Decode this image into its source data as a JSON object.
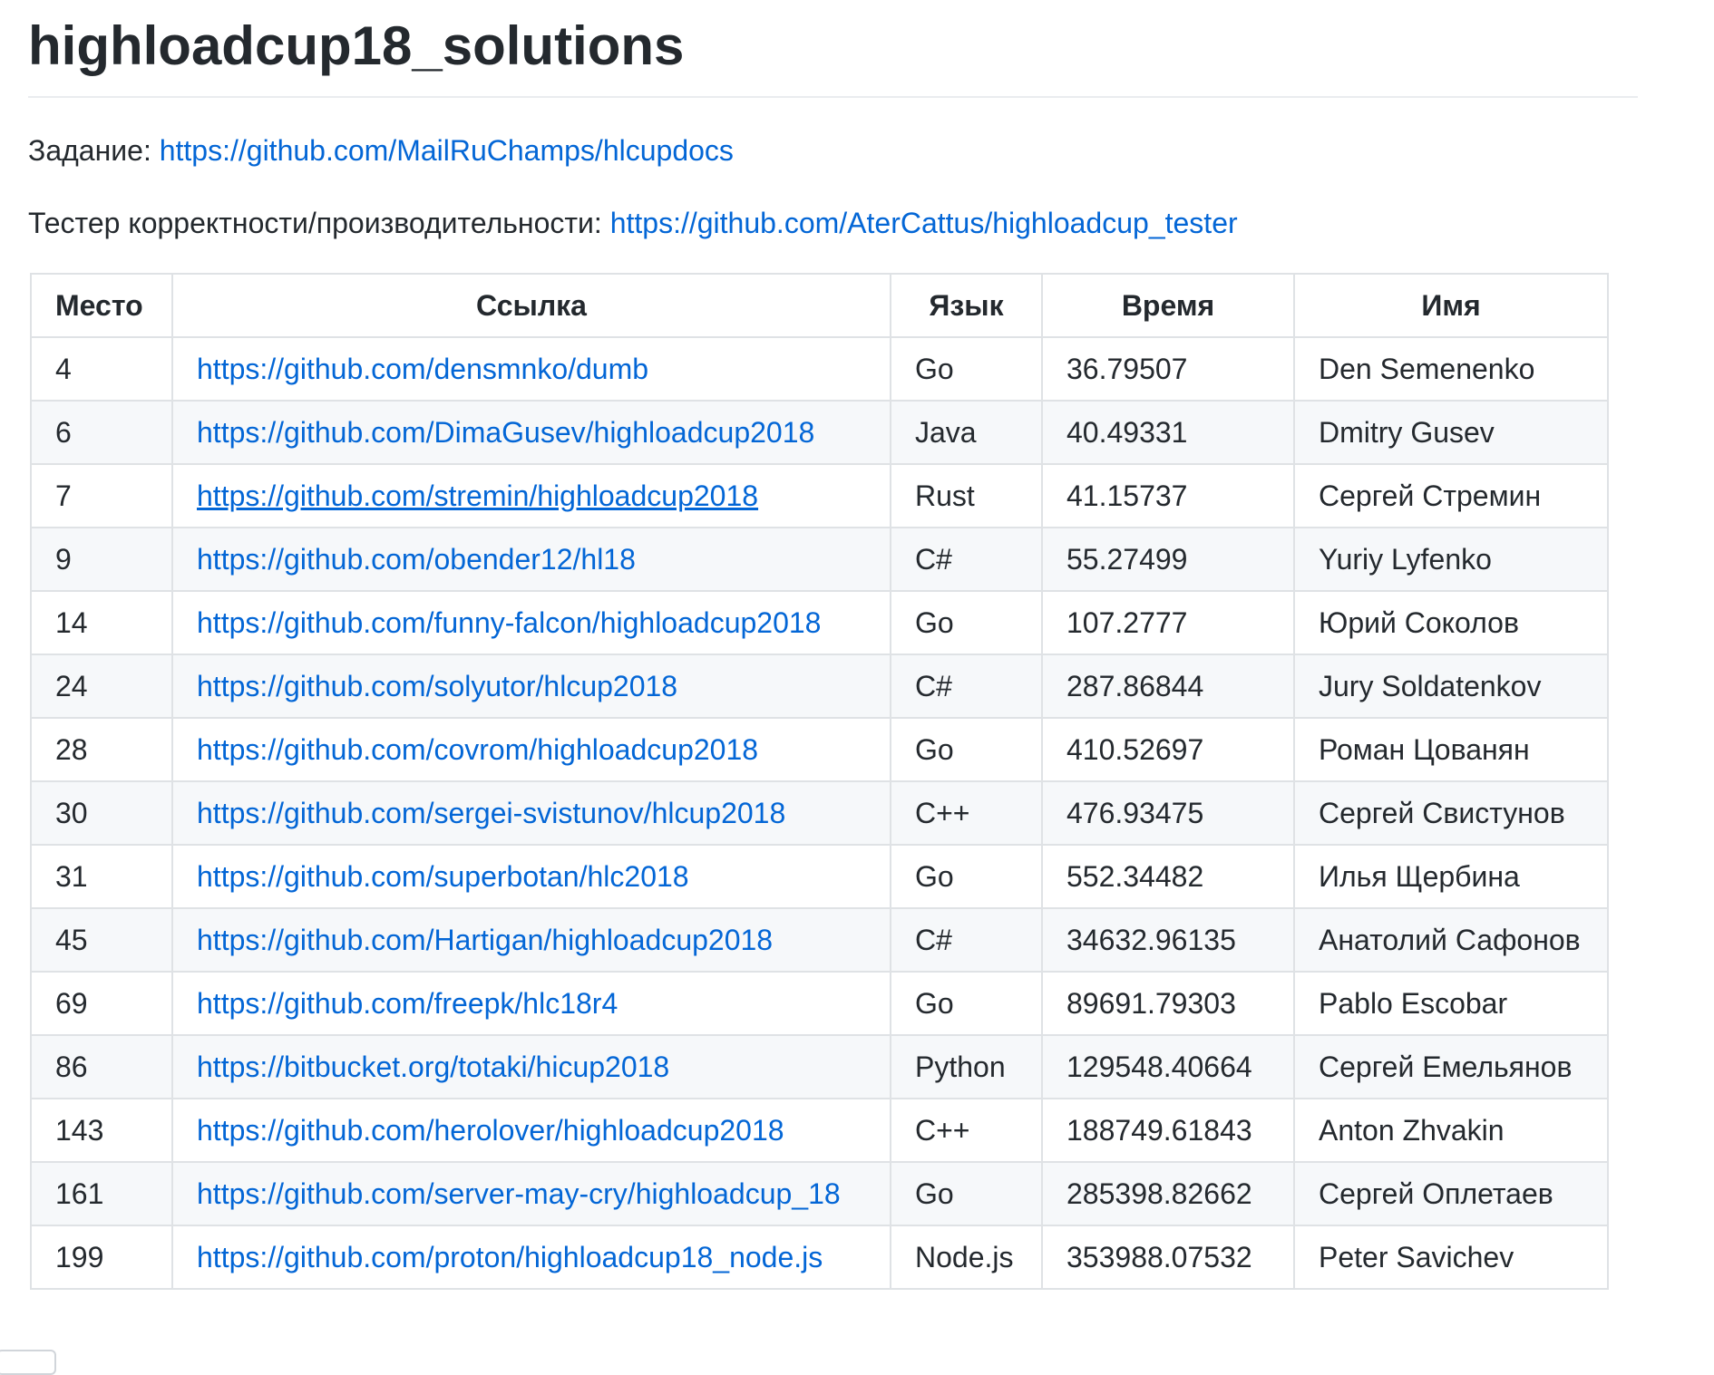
{
  "title": "highloadcup18_solutions",
  "task": {
    "label": "Задание: ",
    "url": "https://github.com/MailRuChamps/hlcupdocs"
  },
  "tester": {
    "label": "Тестер корректности/производительности: ",
    "url": "https://github.com/AterCattus/highloadcup_tester"
  },
  "table": {
    "headers": [
      "Место",
      "Ссылка",
      "Язык",
      "Время",
      "Имя"
    ],
    "rows": [
      {
        "place": "4",
        "link": "https://github.com/densmnko/dumb",
        "lang": "Go",
        "time": "36.79507",
        "name": "Den Semenenko"
      },
      {
        "place": "6",
        "link": "https://github.com/DimaGusev/highloadcup2018",
        "lang": "Java",
        "time": "40.49331",
        "name": "Dmitry Gusev"
      },
      {
        "place": "7",
        "link": "https://github.com/stremin/highloadcup2018",
        "lang": "Rust",
        "time": "41.15737",
        "name": "Сергей Стремин",
        "underlined": true
      },
      {
        "place": "9",
        "link": "https://github.com/obender12/hl18",
        "lang": "C#",
        "time": "55.27499",
        "name": "Yuriy Lyfenko"
      },
      {
        "place": "14",
        "link": "https://github.com/funny-falcon/highloadcup2018",
        "lang": "Go",
        "time": "107.2777",
        "name": "Юрий Соколов"
      },
      {
        "place": "24",
        "link": "https://github.com/solyutor/hlcup2018",
        "lang": "C#",
        "time": "287.86844",
        "name": "Jury Soldatenkov"
      },
      {
        "place": "28",
        "link": "https://github.com/covrom/highloadcup2018",
        "lang": "Go",
        "time": "410.52697",
        "name": "Роман Цованян"
      },
      {
        "place": "30",
        "link": "https://github.com/sergei-svistunov/hlcup2018",
        "lang": "C++",
        "time": "476.93475",
        "name": "Сергей Свистунов"
      },
      {
        "place": "31",
        "link": "https://github.com/superbotan/hlc2018",
        "lang": "Go",
        "time": "552.34482",
        "name": "Илья Щербина"
      },
      {
        "place": "45",
        "link": "https://github.com/Hartigan/highloadcup2018",
        "lang": "C#",
        "time": "34632.96135",
        "name": "Анатолий Сафонов"
      },
      {
        "place": "69",
        "link": "https://github.com/freepk/hlc18r4",
        "lang": "Go",
        "time": "89691.79303",
        "name": "Pablo Escobar"
      },
      {
        "place": "86",
        "link": "https://bitbucket.org/totaki/hicup2018",
        "lang": "Python",
        "time": "129548.40664",
        "name": "Сергей Емельянов"
      },
      {
        "place": "143",
        "link": "https://github.com/herolover/highloadcup2018",
        "lang": "C++",
        "time": "188749.61843",
        "name": "Anton Zhvakin"
      },
      {
        "place": "161",
        "link": "https://github.com/server-may-cry/highloadcup_18",
        "lang": "Go",
        "time": "285398.82662",
        "name": "Сергей Оплетаев"
      },
      {
        "place": "199",
        "link": "https://github.com/proton/highloadcup18_node.js",
        "lang": "Node.js",
        "time": "353988.07532",
        "name": "Peter Savichev"
      }
    ]
  },
  "colors": {
    "link": "#0366d6",
    "text": "#24292e",
    "border": "#dfe2e5",
    "stripe": "#f6f8fa"
  }
}
